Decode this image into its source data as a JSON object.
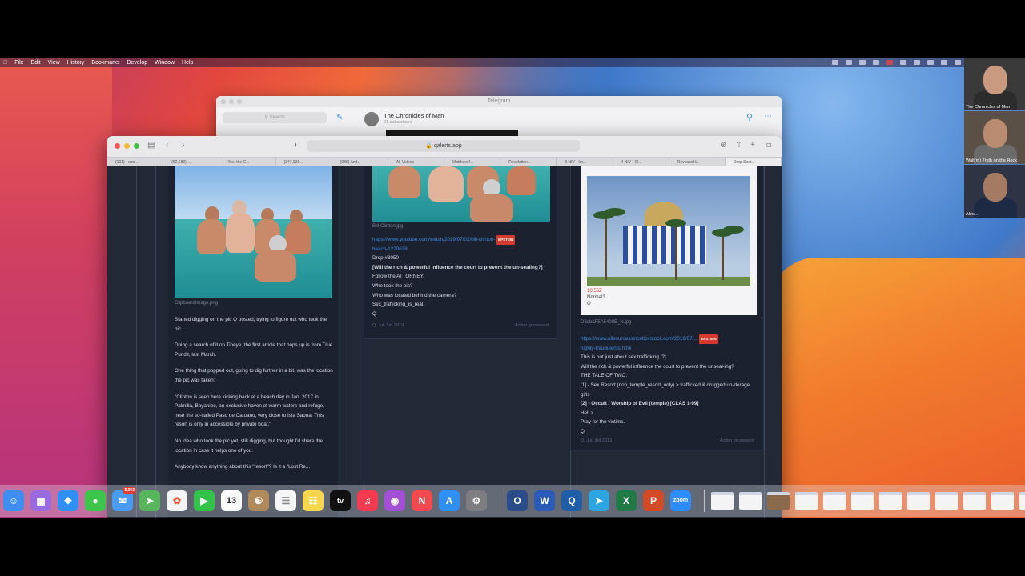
{
  "menubar": {
    "items": [
      "File",
      "Edit",
      "View",
      "History",
      "Bookmarks",
      "Develop",
      "Window",
      "Help"
    ]
  },
  "telegram": {
    "window_title": "Telegram",
    "search_placeholder": "Search",
    "chat_title": "The Chronicles of Man",
    "subscribers": "21 subscribers"
  },
  "safari": {
    "url": "qalerts.app",
    "tabs": [
      "(101) - abc...",
      "(82,683) -...",
      "Yes, the C...",
      "(347,931...",
      "(986) And...",
      "All Videos",
      "Matthew f...",
      "Revelation...",
      "3 NIV - Im...",
      "4 NIV - Cl...",
      "Revealed t...",
      "Drop Sear..."
    ]
  },
  "post1": {
    "caption": "ClipboardImage.png",
    "paragraphs": [
      "Started digging on the pic Q posted, trying to figure out who took the pic.",
      "Doing a search of it on Tineye, the first article that pops up is from True Pundit, last March.",
      "One thing that popped out, going to dig further in a bit, was the location the pic was taken:",
      "\"Clinton is seen here kicking back at a beach day in Jan. 2017 in Palmilla, Bayahibe, an exclusive haven of warm waters and refuge, near the so-called Paso de Catuano, very close to Isla Saona. This resort is only in accessible by private boat.\"",
      "No idea who took the pic yet, still digging, but thought I'd share the location in case it helps one of you.",
      "Anybody know anything about this \"resort\"? Is it a \"Lost Re..."
    ]
  },
  "post2": {
    "caption": "Bill-Clinton.jpg",
    "link": "https://www.youtube.com/watch/2019/07/02/bill-clinton-",
    "badge": "EPSTEIN",
    "link2": "beach-1220638",
    "lines": [
      "Drop #3050",
      "[Will the rich & powerful influence the court to prevent the un-sealing?]",
      "Follow the ATTORNEY.",
      "Who took the pic?",
      "Who was located behind the camera?",
      "Sex_trafficking_is_real.",
      "Q"
    ],
    "meta": "Q, Jul. 3rd 2019",
    "action": "Action grossword"
  },
  "post3": {
    "inner_caption": "10:56Z",
    "inner_lines": [
      "Normal?",
      "Q"
    ],
    "caption": "D6db1F5A5408E_N.jpg",
    "link": "https://www.allsourcessinceltovstock.com/2019/07/...",
    "badge": "EPSTEIN",
    "link2": "highly-fraudulents.html",
    "lines": [
      "This is not just about sex trafficking [?].",
      "Will the rich & powerful influence the court to prevent the unseal-ing?",
      "THE TALE OF TWO:",
      "[1] - Sex Resort (non_temple_resort_only) > trafficked & drugged un-derage girls",
      "[2] - Occult / Worship of Evil (temple) [CLAS 1-99]",
      "Hell >",
      "Pray for the victims.",
      "Q"
    ],
    "meta": "Q, Jul. 3rd 2019",
    "action": "Action grossword"
  },
  "webcams": [
    "The Chronicles of Man",
    "Walt(m) Truth on the Rock",
    "Alex..."
  ],
  "dock": {
    "calendar_day": "13",
    "mail_badge": "5,053",
    "tv_label": "tv",
    "zoom_label": "zoom"
  }
}
